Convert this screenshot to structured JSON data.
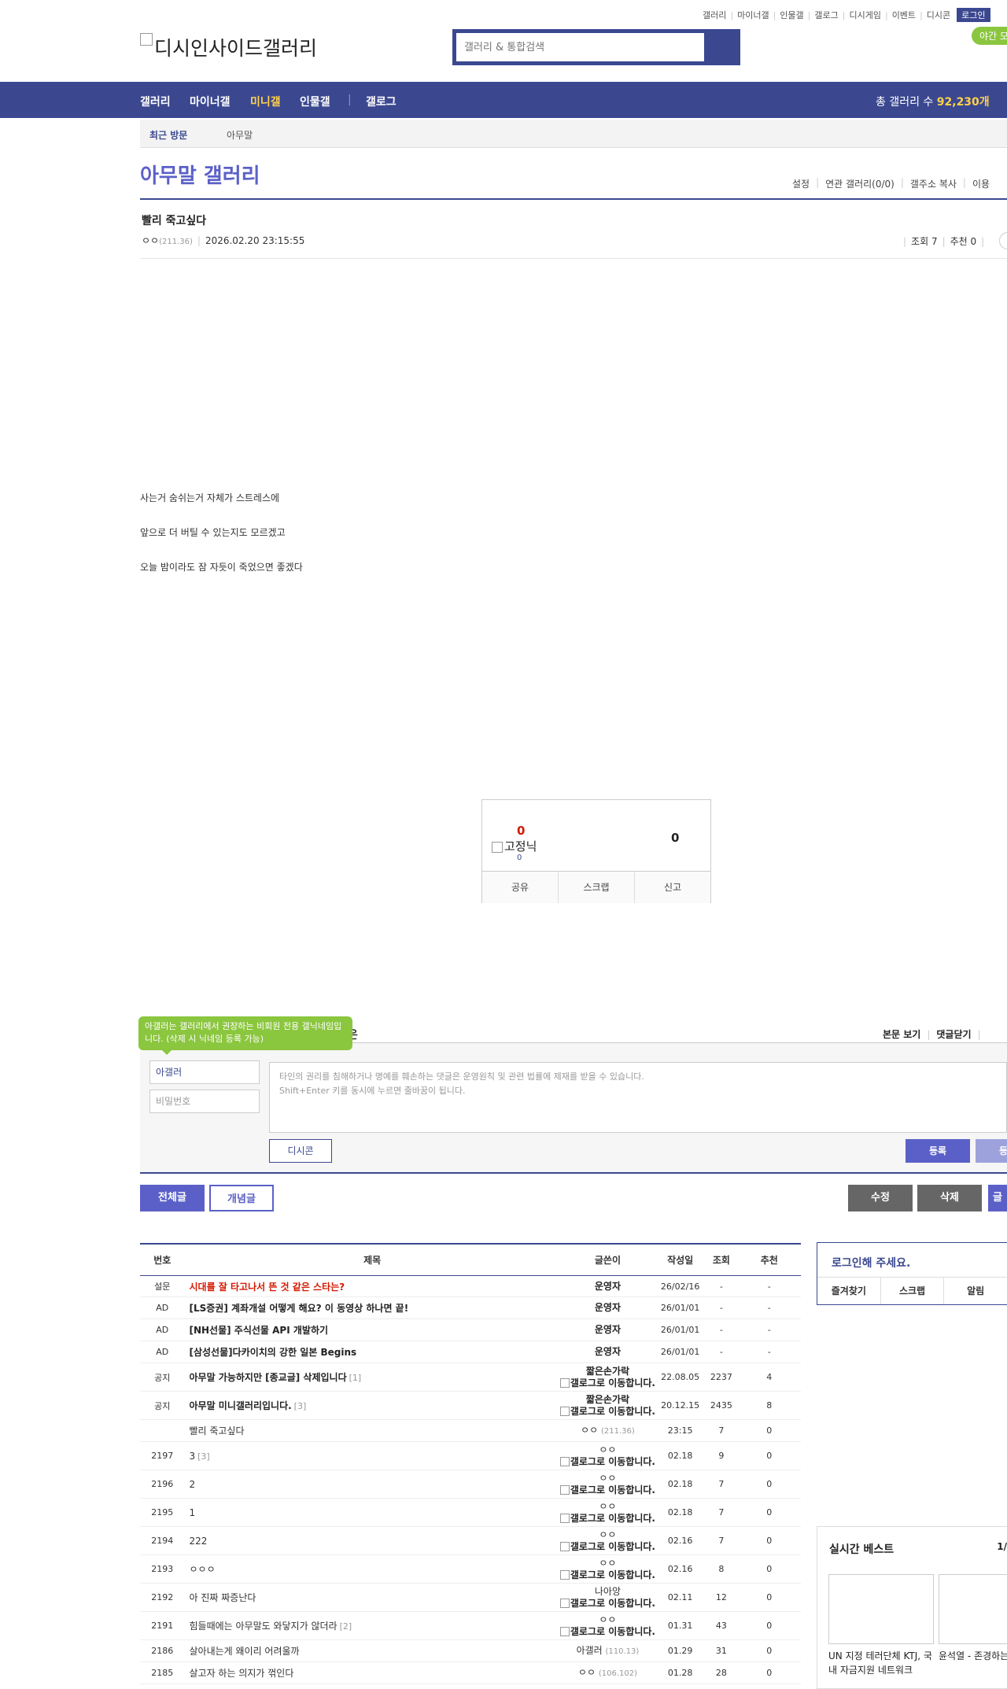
{
  "top_links": [
    "갤러리",
    "마이너갤",
    "인물갤",
    "갤로그",
    "디시게임",
    "이벤트",
    "디시콘"
  ],
  "login_label": "로그인",
  "dark_mode_label": "야간 모",
  "logo_alt": "디시인사이드갤러리",
  "search": {
    "placeholder": "갤러리 & 통합검색"
  },
  "gnb": {
    "items": [
      "갤러리",
      "마이너갤",
      "미니갤",
      "인물갤",
      "갤로그"
    ],
    "total_label": "총 갤러리 수",
    "total_value": "92,230개"
  },
  "recent": {
    "label": "최근 방문",
    "item": "아무말"
  },
  "gallery": {
    "title": "아무말 갤러리",
    "menu": [
      "설정",
      "연관 갤러리(0/0)",
      "갤주소 복사",
      "이용"
    ]
  },
  "post": {
    "title": "빨리 죽고싶다",
    "writer": "ㅇㅇ",
    "ip": "(211.36)",
    "date": "2026.02.20 23:15:55",
    "views": "조회 7",
    "recommend": "추천 0",
    "body": [
      "사는거 숨쉬는거 자체가 스트레스에",
      "앞으로 더 버틸 수 있는지도 모르겠고",
      "오늘 밤이라도 잠 자듯이 죽었으면 좋겠다"
    ]
  },
  "recommend_box": {
    "up": "0",
    "fixed_label": "고정닉",
    "fixed_count": "0",
    "down": "0",
    "actions": [
      "공유",
      "스크랩",
      "신고"
    ]
  },
  "comments": {
    "tooltip": "아갤러는 갤러리에서 권장하는 비회원 전용 갤닉네임입니다. (삭제 시 닉네임 등록 가능)",
    "head_tail": "은",
    "opts": [
      "본문 보기",
      "댓글닫기"
    ],
    "nick_value": "아갤러",
    "password_placeholder": "비밀번호",
    "textarea_lines": [
      "타인의 권리를 침해하거나 명예를 훼손하는 댓글은 운영원칙 및 관련 법률에 제재를 받을 수 있습니다.",
      "Shift+Enter 키를 동시에 누르면 줄바꿈이 됩니다."
    ],
    "dccon_label": "디시콘",
    "submit_label": "등록",
    "submit2_label": "등록"
  },
  "list_buttons": {
    "all": "전체글",
    "concept": "개념글",
    "edit": "수정",
    "delete": "삭제",
    "write": "글"
  },
  "list": {
    "headers": [
      "번호",
      "제목",
      "글쓴이",
      "작성일",
      "조회",
      "추천"
    ],
    "rows": [
      {
        "num": "설문",
        "title": "시대를 잘 타고나서 뜬 것 같은 스타는?",
        "reply": "",
        "writer": "운영자",
        "ip": "",
        "sub": "",
        "date": "26/02/16",
        "views": "-",
        "rec": "-",
        "style": "red",
        "writer_style": "bold",
        "h": 27
      },
      {
        "num": "AD",
        "title": "[LS증권] 계좌개설 어떻게 해요? 이 동영상 하나면 끝!",
        "reply": "",
        "writer": "운영자",
        "ip": "",
        "sub": "",
        "date": "26/01/01",
        "views": "-",
        "rec": "-",
        "style": "bold",
        "writer_style": "bold",
        "h": 28
      },
      {
        "num": "AD",
        "title": "[NH선물] 주식선물 API 개발하기",
        "reply": "",
        "writer": "운영자",
        "ip": "",
        "sub": "",
        "date": "26/01/01",
        "views": "-",
        "rec": "-",
        "style": "bold",
        "writer_style": "bold",
        "h": 28
      },
      {
        "num": "AD",
        "title": "[삼성선물]다카이치의 강한 일본 Begins",
        "reply": "",
        "writer": "운영자",
        "ip": "",
        "sub": "",
        "date": "26/01/01",
        "views": "-",
        "rec": "-",
        "style": "bold",
        "writer_style": "bold",
        "h": 28
      },
      {
        "num": "공지",
        "title": "아무말 가능하지만 [종교글] 삭제입니다",
        "reply": "[1]",
        "writer": "짧은손가락",
        "ip": "",
        "sub": "갤로그로 이동합니다.",
        "date": "22.08.05",
        "views": "2237",
        "rec": "4",
        "style": "bold",
        "writer_style": "bold",
        "h": 36
      },
      {
        "num": "공지",
        "title": "아무말 미니갤러리입니다.",
        "reply": "[3]",
        "writer": "짧은손가락",
        "ip": "",
        "sub": "갤로그로 이동합니다.",
        "date": "20.12.15",
        "views": "2435",
        "rec": "8",
        "style": "bold",
        "writer_style": "bold",
        "h": 36
      },
      {
        "num": "",
        "title": "빨리 죽고싶다",
        "reply": "",
        "writer": "ㅇㅇ",
        "ip": "(211.36)",
        "sub": "",
        "date": "23:15",
        "views": "7",
        "rec": "0",
        "style": "",
        "writer_style": "",
        "h": 28
      },
      {
        "num": "2197",
        "title": "3",
        "reply": "[3]",
        "writer": "ㅇㅇ",
        "ip": "",
        "sub": "갤로그로 이동합니다.",
        "date": "02.18",
        "views": "9",
        "rec": "0",
        "style": "",
        "writer_style": "",
        "h": 36
      },
      {
        "num": "2196",
        "title": "2",
        "reply": "",
        "writer": "ㅇㅇ",
        "ip": "",
        "sub": "갤로그로 이동합니다.",
        "date": "02.18",
        "views": "7",
        "rec": "0",
        "style": "",
        "writer_style": "",
        "h": 36
      },
      {
        "num": "2195",
        "title": "1",
        "reply": "",
        "writer": "ㅇㅇ",
        "ip": "",
        "sub": "갤로그로 이동합니다.",
        "date": "02.18",
        "views": "7",
        "rec": "0",
        "style": "",
        "writer_style": "",
        "h": 36
      },
      {
        "num": "2194",
        "title": "222",
        "reply": "",
        "writer": "ㅇㅇ",
        "ip": "",
        "sub": "갤로그로 이동합니다.",
        "date": "02.16",
        "views": "7",
        "rec": "0",
        "style": "",
        "writer_style": "",
        "h": 36
      },
      {
        "num": "2193",
        "title": "ㅇㅇㅇ",
        "reply": "",
        "writer": "ㅇㅇ",
        "ip": "",
        "sub": "갤로그로 이동합니다.",
        "date": "02.16",
        "views": "8",
        "rec": "0",
        "style": "",
        "writer_style": "",
        "h": 36
      },
      {
        "num": "2192",
        "title": "아 진짜 짜증난다",
        "reply": "",
        "writer": "나아앙",
        "ip": "",
        "sub": "갤로그로 이동합니다.",
        "date": "02.11",
        "views": "12",
        "rec": "0",
        "style": "",
        "writer_style": "",
        "h": 36
      },
      {
        "num": "2191",
        "title": "힘들때에는 아무말도 와닿지가 않더라",
        "reply": "[2]",
        "writer": "ㅇㅇ",
        "ip": "",
        "sub": "갤로그로 이동합니다.",
        "date": "01.31",
        "views": "43",
        "rec": "0",
        "style": "",
        "writer_style": "",
        "h": 36
      },
      {
        "num": "2186",
        "title": "살아내는게 왜이리 어려울까",
        "reply": "",
        "writer": "아갤러",
        "ip": "(110.13)",
        "sub": "",
        "date": "01.29",
        "views": "31",
        "rec": "0",
        "style": "",
        "writer_style": "",
        "h": 28
      },
      {
        "num": "2185",
        "title": "살고자 하는 의지가 꺾인다",
        "reply": "",
        "writer": "ㅇㅇ",
        "ip": "(106.102)",
        "sub": "",
        "date": "01.28",
        "views": "28",
        "rec": "0",
        "style": "",
        "writer_style": "",
        "h": 28
      }
    ]
  },
  "side": {
    "login_prompt": "로그인해 주세요.",
    "login_bar": [
      "즐겨찾기",
      "스크랩",
      "알림"
    ],
    "best_title": "실시간 베스트",
    "best_page": "1/",
    "best_items": [
      {
        "caption": "UN 지정 테러단체 KTJ, 국내 자금지원 네트워크"
      },
      {
        "caption": "윤석열 - 존경하는 여러분"
      }
    ]
  },
  "colors": {
    "brand": "#3b4890",
    "accent": "#5b60c8",
    "green": "#8bc63f",
    "red": "#d31900"
  }
}
